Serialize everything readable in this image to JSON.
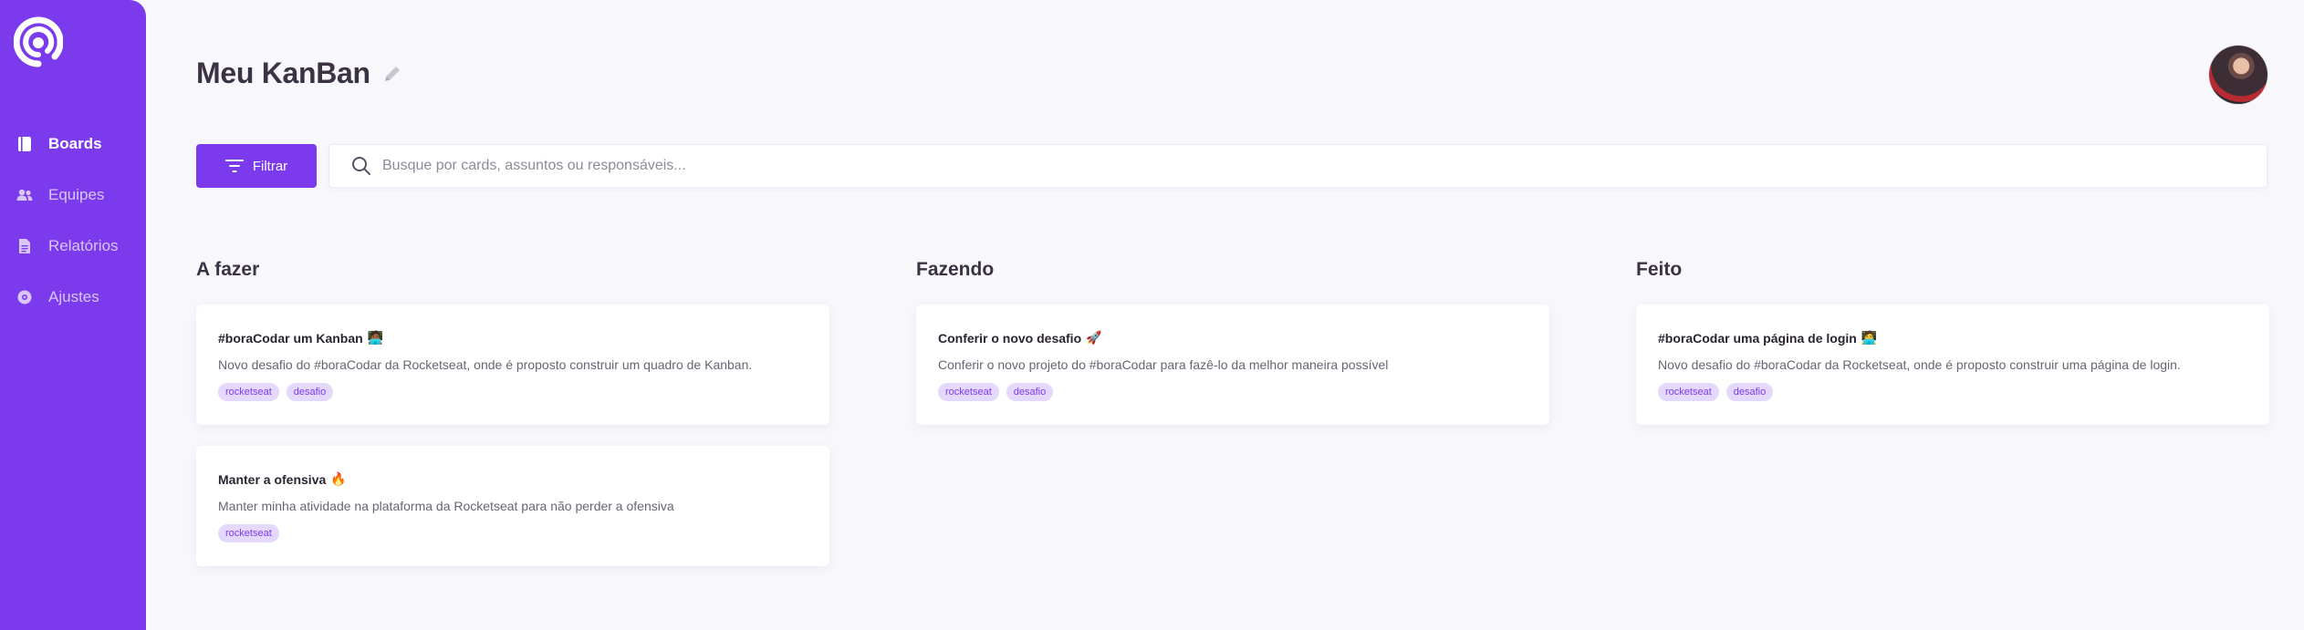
{
  "sidebar": {
    "items": [
      {
        "label": "Boards",
        "icon": "book-icon",
        "active": true
      },
      {
        "label": "Equipes",
        "icon": "users-icon",
        "active": false
      },
      {
        "label": "Relatórios",
        "icon": "document-icon",
        "active": false
      },
      {
        "label": "Ajustes",
        "icon": "settings-icon",
        "active": false
      }
    ]
  },
  "header": {
    "title": "Meu KanBan"
  },
  "toolbar": {
    "filter_label": "Filtrar",
    "search_placeholder": "Busque por cards, assuntos ou responsáveis...",
    "search_value": ""
  },
  "columns": [
    {
      "title": "A fazer",
      "cards": [
        {
          "title": "#boraCodar um Kanban",
          "emoji": "🧑🏾‍💻",
          "description": "Novo desafio do #boraCodar da Rocketseat, onde é proposto construir um quadro de Kanban.",
          "tags": [
            "rocketseat",
            "desafio"
          ]
        },
        {
          "title": "Manter a ofensiva",
          "emoji": "🔥",
          "description": "Manter minha atividade na plataforma da Rocketseat para não perder a ofensiva",
          "tags": [
            "rocketseat"
          ]
        }
      ]
    },
    {
      "title": "Fazendo",
      "cards": [
        {
          "title": "Conferir o novo desafio",
          "emoji": "🚀",
          "description": "Conferir o novo projeto do #boraCodar para fazê-lo da melhor maneira possível",
          "tags": [
            "rocketseat",
            "desafio"
          ]
        }
      ]
    },
    {
      "title": "Feito",
      "cards": [
        {
          "title": "#boraCodar uma página de login",
          "emoji": "🧑‍💻",
          "description": "Novo desafio do #boraCodar da Rocketseat, onde é proposto construir uma página de login.",
          "tags": [
            "rocketseat",
            "desafio"
          ]
        }
      ]
    }
  ],
  "colors": {
    "brand": "#7c3aed",
    "background": "#f8f8fc",
    "tag_bg": "#e4d8fd"
  }
}
